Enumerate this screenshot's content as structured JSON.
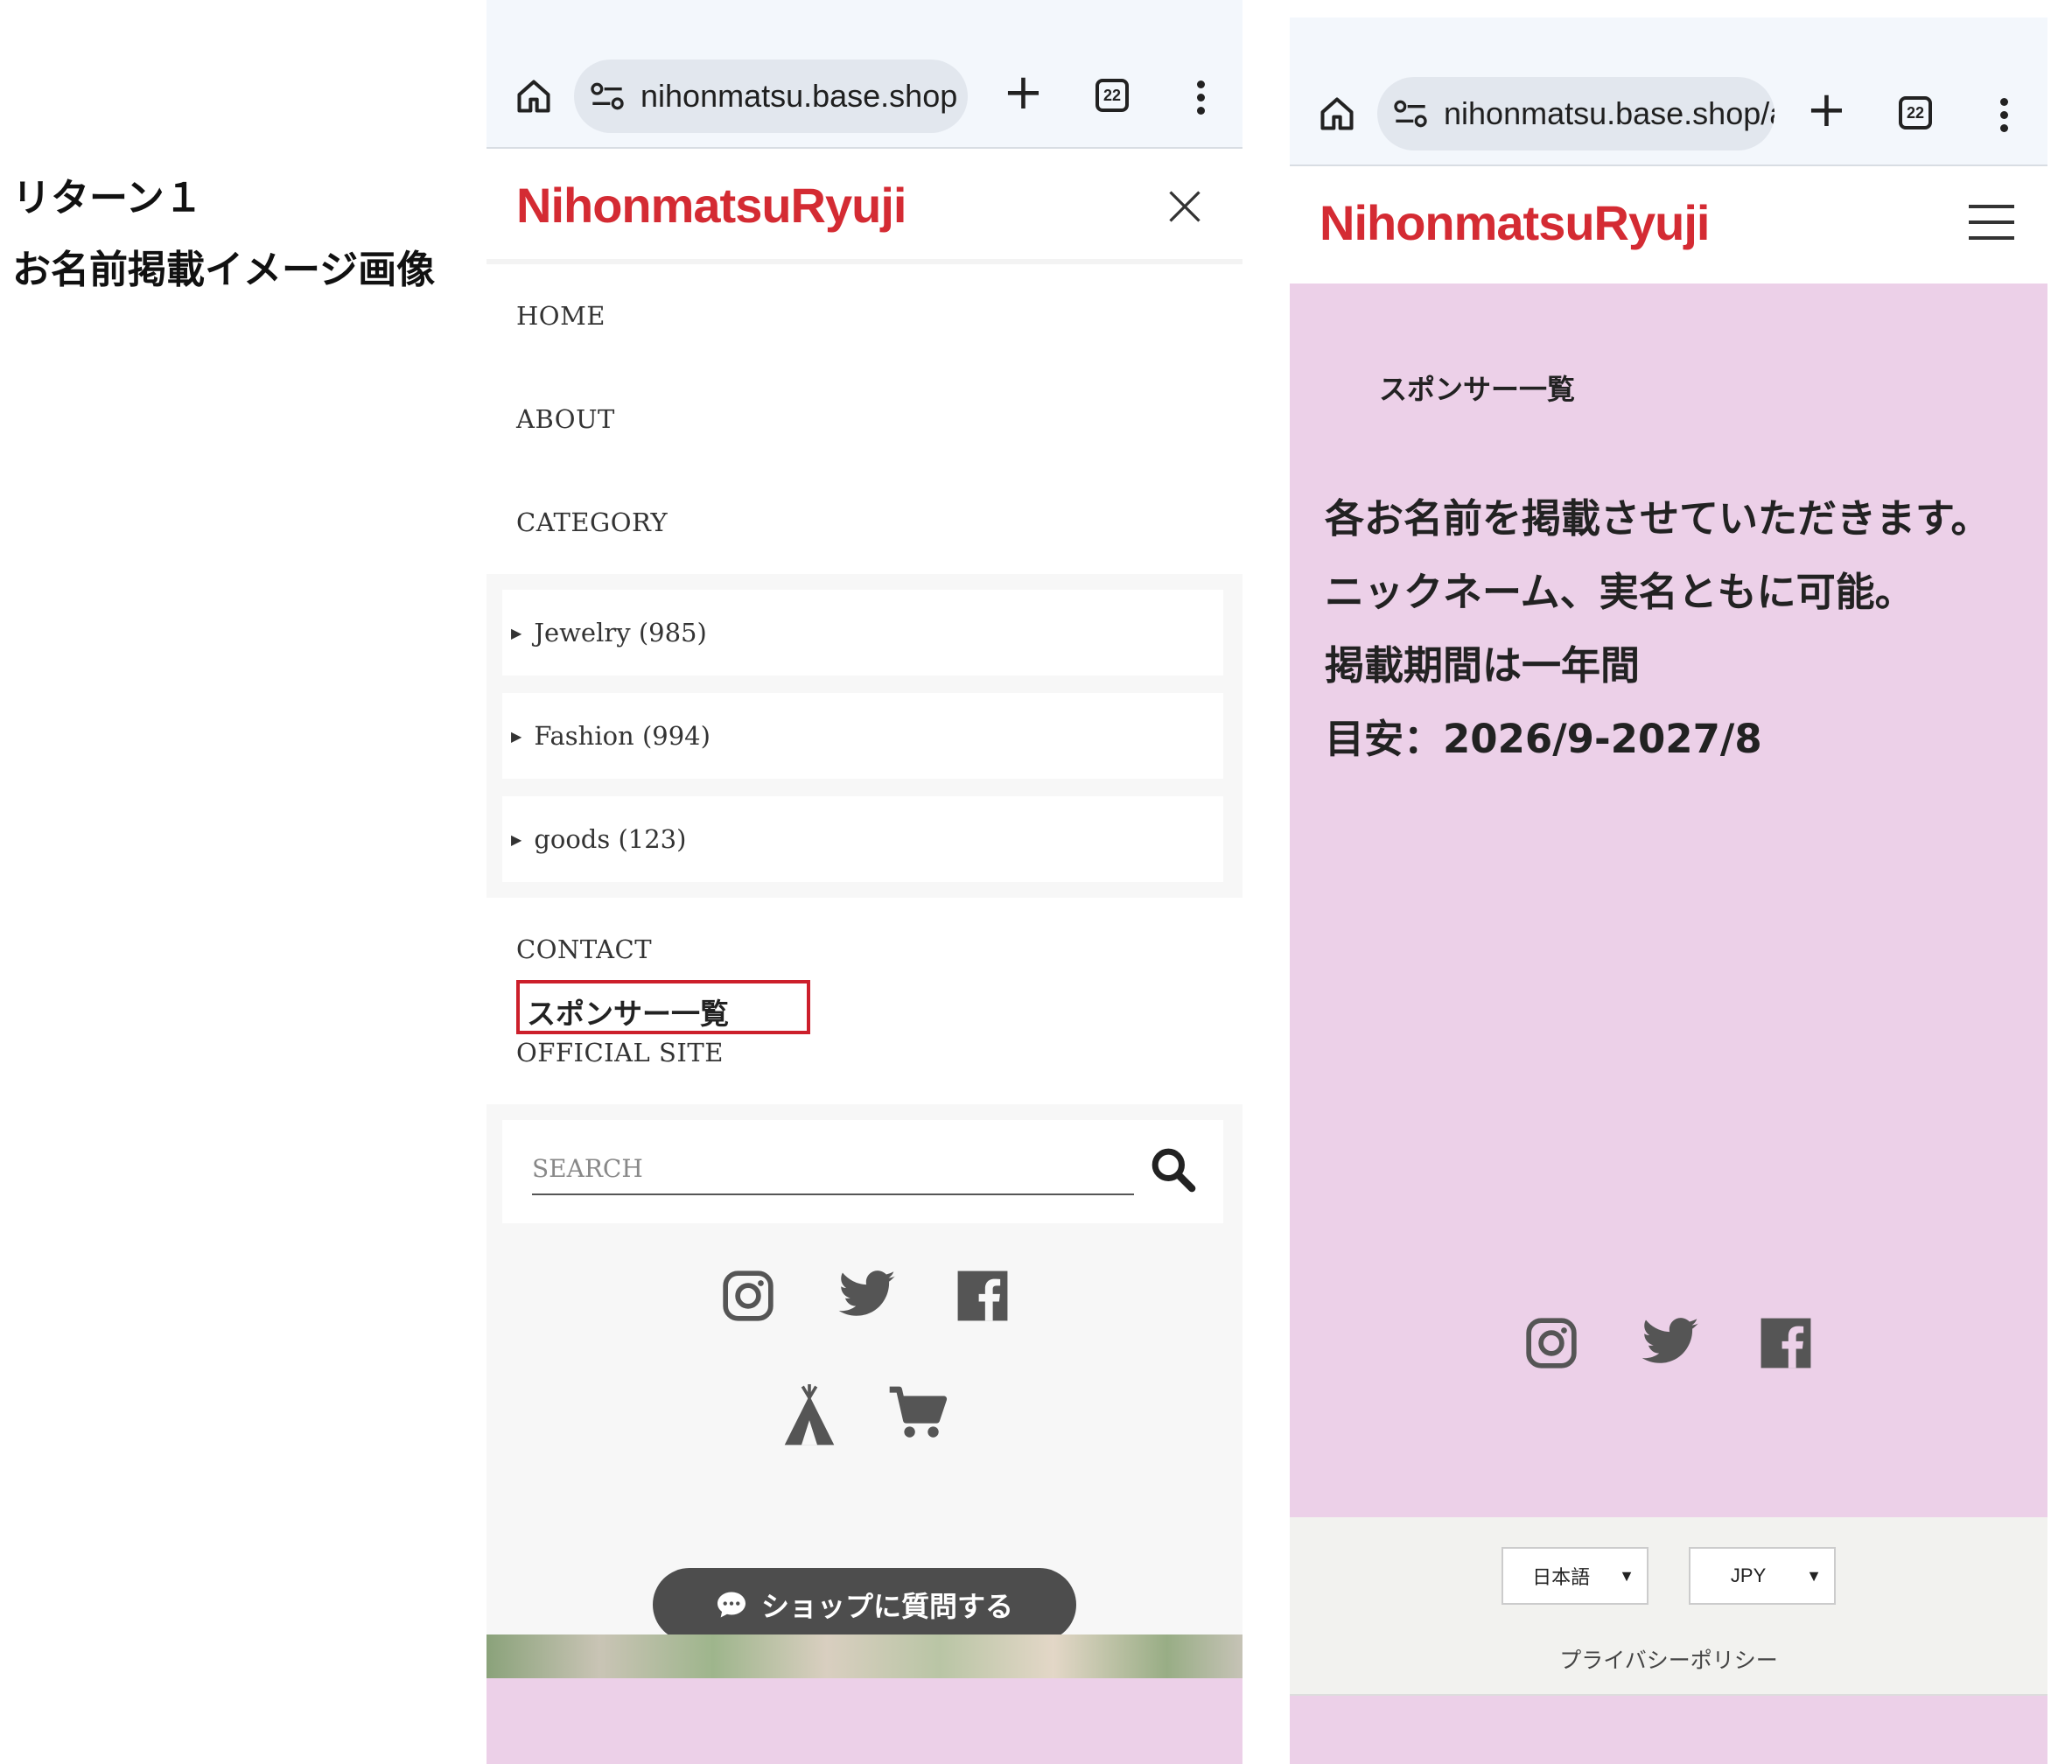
{
  "caption": {
    "line1": "リターン１",
    "line2": "お名前掲載イメージ画像"
  },
  "left_phone": {
    "browser": {
      "url": "nihonmatsu.base.shop",
      "tab_count": "22"
    },
    "header": {
      "logo": "NihonmatsuRyuji"
    },
    "menu": {
      "home": "HOME",
      "about": "ABOUT",
      "category": "CATEGORY",
      "categories": [
        {
          "label": "Jewelry (985)"
        },
        {
          "label": "Fashion (994)"
        },
        {
          "label": "goods (123)"
        }
      ],
      "contact": "CONTACT",
      "sponsor": "スポンサー一覧",
      "official": "OFFICIAL SITE"
    },
    "search": {
      "placeholder": "SEARCH"
    },
    "chat_button": "ショップに質問する"
  },
  "right_phone": {
    "browser": {
      "url": "nihonmatsu.base.shop/a",
      "tab_count": "22"
    },
    "header": {
      "logo": "NihonmatsuRyuji"
    },
    "content": {
      "title": "スポンサー一覧",
      "lines": [
        "各お名前を掲載させていただきます。",
        "ニックネーム、実名ともに可能。",
        "掲載期間は一年間",
        "目安：2026/9-2027/8"
      ]
    },
    "footer": {
      "language": "日本語",
      "currency": "JPY",
      "privacy": "プライバシーポリシー"
    }
  },
  "colors": {
    "logo": "#d42b33",
    "pink_bg": "#ecd0e8",
    "highlight_box": "#cc1f2b",
    "icon_gray": "#555555"
  }
}
